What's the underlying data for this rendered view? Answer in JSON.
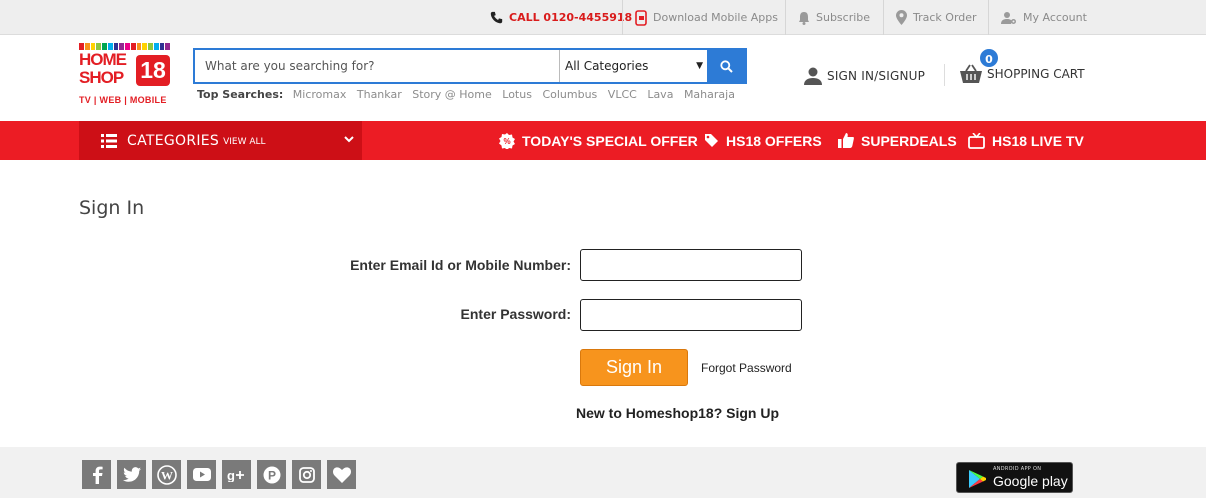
{
  "topbar": {
    "call": "CALL 0120-4455918",
    "apps": "Download Mobile Apps",
    "subscribe": "Subscribe",
    "track": "Track Order",
    "account": "My Account"
  },
  "logo": {
    "line1": "HOME",
    "line2": "SHOP",
    "num": "18",
    "tagline": "TV | WEB | MOBILE",
    "stripe_colors": [
      "#e31e24",
      "#f7941d",
      "#ffd200",
      "#8dc63f",
      "#00a651",
      "#00aeef",
      "#2e3192",
      "#92278f",
      "#ec008c",
      "#e31e24",
      "#f7941d",
      "#ffd200",
      "#8dc63f",
      "#00aeef",
      "#2e3192",
      "#92278f"
    ]
  },
  "search": {
    "placeholder": "What are you searching for?",
    "category": "All Categories"
  },
  "top_searches": {
    "label": "Top Searches:",
    "items": [
      "Micromax",
      "Thankar",
      "Story @ Home",
      "Lotus",
      "Columbus",
      "VLCC",
      "Lava",
      "Maharaja"
    ]
  },
  "header": {
    "signin": "SIGN IN/SIGNUP",
    "cart": "SHOPPING CART",
    "cart_count": "0"
  },
  "nav": {
    "categories": "CATEGORIES",
    "view_all": "VIEW ALL",
    "offer": "TODAY'S SPECIAL OFFER",
    "hs18_offers": "HS18 OFFERS",
    "superdeals": "SUPERDEALS",
    "live_tv": "HS18 LIVE TV"
  },
  "signin_form": {
    "title": "Sign In",
    "email_label": "Enter Email Id or Mobile Number:",
    "password_label": "Enter Password:",
    "email_value": "",
    "password_value": "",
    "submit": "Sign In",
    "forgot": "Forgot Password",
    "new_to": "New to Homeshop18?",
    "signup": "Sign Up"
  },
  "footer": {
    "social_icons": [
      "facebook-icon",
      "twitter-icon",
      "wordpress-icon",
      "youtube-icon",
      "google-plus-icon",
      "pinterest-icon",
      "instagram-icon",
      "heart-icon"
    ],
    "gplay_small": "ANDROID APP ON",
    "gplay_big": "Google play"
  },
  "colors": {
    "brand_red": "#ec1c24",
    "nav_dark_red": "#cd0f16",
    "accent_blue": "#2d7bd6",
    "button_orange": "#f7941d"
  }
}
